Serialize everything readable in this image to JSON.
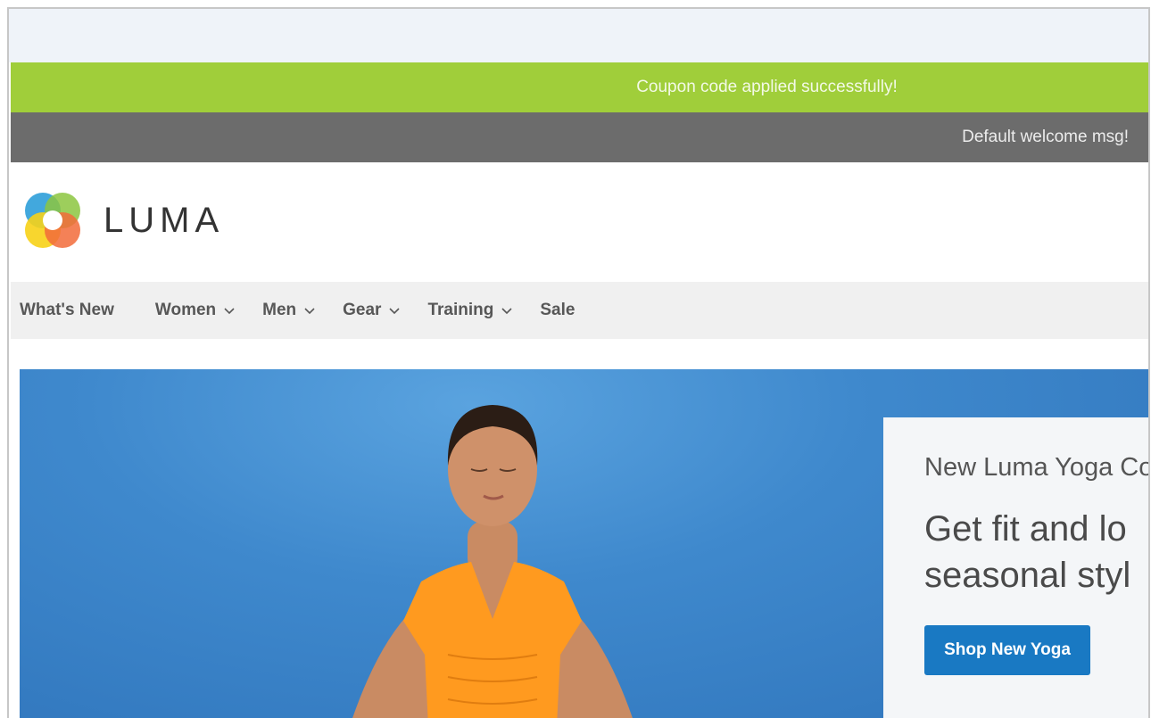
{
  "messages": {
    "coupon_success": "Coupon code applied successfully!"
  },
  "header": {
    "welcome": "Default welcome msg!",
    "logo_text": "LUMA"
  },
  "nav": {
    "items": [
      {
        "label": "What's New",
        "has_dropdown": false
      },
      {
        "label": "Women",
        "has_dropdown": true
      },
      {
        "label": "Men",
        "has_dropdown": true
      },
      {
        "label": "Gear",
        "has_dropdown": true
      },
      {
        "label": "Training",
        "has_dropdown": true
      },
      {
        "label": "Sale",
        "has_dropdown": false
      }
    ]
  },
  "hero": {
    "eyebrow": "New Luma Yoga Co",
    "headline_line1": "Get fit and lo",
    "headline_line2": "seasonal styl",
    "cta_label": "Shop New Yoga"
  },
  "colors": {
    "success_bar": "#a0ce3a",
    "welcome_bar": "#6c6c6c",
    "nav_bg": "#f0f0f0",
    "cta": "#1979c3",
    "hero_sky": "#3f89cd",
    "shirt": "#ff9a1f"
  },
  "icons": {
    "logo": "luma-logo-icon",
    "dropdown": "chevron-down-icon"
  }
}
